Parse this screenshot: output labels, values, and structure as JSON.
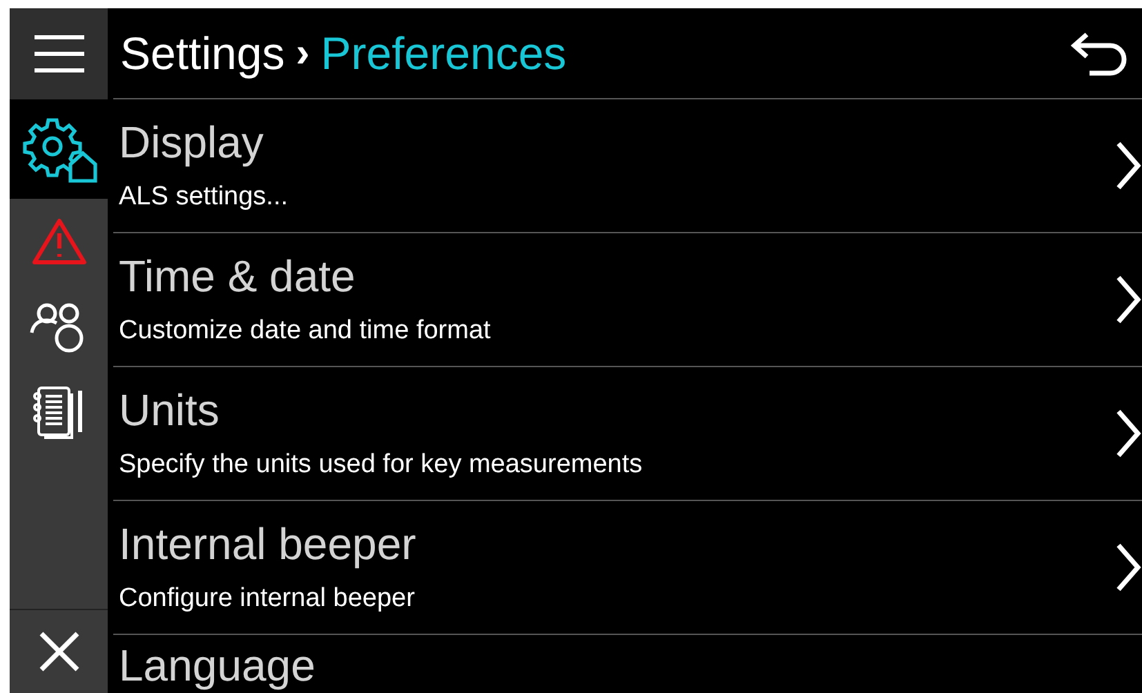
{
  "header": {
    "breadcrumb_parent": "Settings",
    "separator": "›",
    "breadcrumb_current": "Preferences"
  },
  "sidebar": {
    "items": [
      {
        "kind": "gear-home",
        "selected": true
      },
      {
        "kind": "warning",
        "selected": false
      },
      {
        "kind": "users",
        "selected": false
      },
      {
        "kind": "notebook",
        "selected": false
      }
    ]
  },
  "rows": [
    {
      "title": "Display",
      "subtitle": "ALS settings..."
    },
    {
      "title": "Time & date",
      "subtitle": "Customize date and time format"
    },
    {
      "title": "Units",
      "subtitle": "Specify the units used for key measurements"
    },
    {
      "title": "Internal beeper",
      "subtitle": "Configure internal beeper"
    },
    {
      "title": "Language"
    }
  ]
}
